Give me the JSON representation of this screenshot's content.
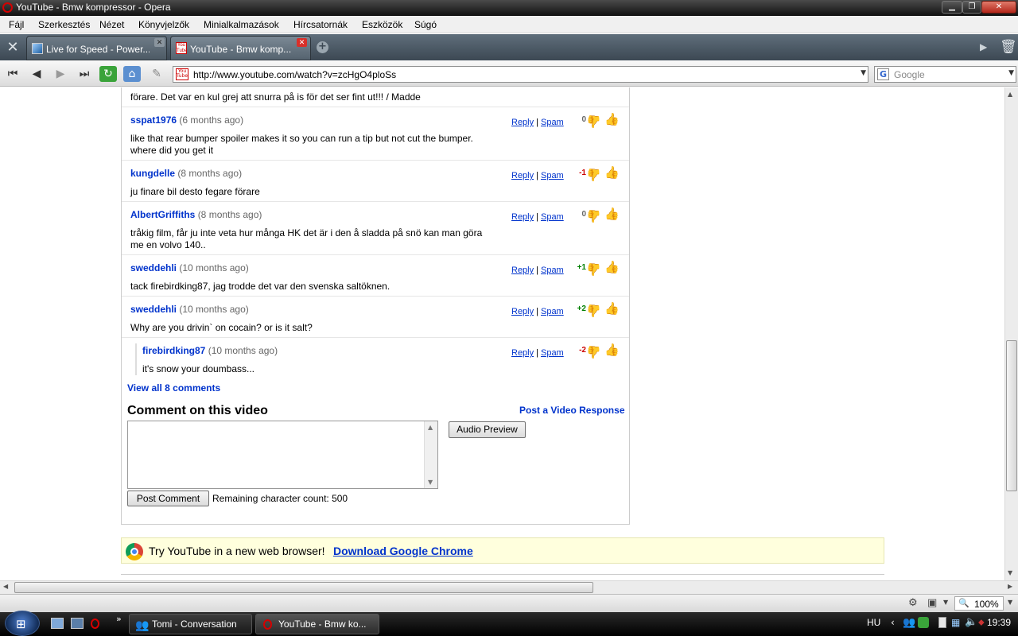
{
  "window": {
    "title": "YouTube - Bmw kompressor - Opera"
  },
  "menu": [
    "Fájl",
    "Szerkesztés",
    "Nézet",
    "Könyvjelzők",
    "Minialkalmazások",
    "Hírcsatornák",
    "Eszközök",
    "Súgó"
  ],
  "tabs": [
    {
      "label": "Live for Speed - Power...",
      "active": false
    },
    {
      "label": "YouTube - Bmw komp...",
      "active": true
    }
  ],
  "address": {
    "url": "http://www.youtube.com/watch?v=zcHgO4ploSs",
    "search_placeholder": "Google"
  },
  "comments": {
    "partial_text": "förare. Det var en kul grej att snurra på is för det ser fint ut!!! / Madde",
    "reply_label": "Reply",
    "spam_label": "Spam",
    "items": [
      {
        "user": "sspat1976",
        "ago": "(6 months ago)",
        "text": "like that rear bumper spoiler makes it so you can run a tip but not cut the bumper. where did you get it",
        "score": "0"
      },
      {
        "user": "kungdelle",
        "ago": "(8 months ago)",
        "text": "ju finare bil desto fegare förare",
        "score": "-1"
      },
      {
        "user": "AlbertGriffiths",
        "ago": "(8 months ago)",
        "text": "tråkig film, får ju inte veta hur många HK det är i den å sladda på snö kan man göra me en volvo 140..",
        "score": "0"
      },
      {
        "user": "sweddehli",
        "ago": "(10 months ago)",
        "text": "tack firebirdking87, jag trodde det var den svenska saltöknen.",
        "score": "+1"
      },
      {
        "user": "sweddehli",
        "ago": "(10 months ago)",
        "text": "Why are you drivin` on cocain? or is it salt?",
        "score": "+2"
      },
      {
        "user": "firebirdking87",
        "ago": "(10 months ago)",
        "text": "it's snow your doumbass...",
        "score": "-2"
      }
    ],
    "view_all": "View all 8 comments",
    "heading": "Comment on this video",
    "post_video_response": "Post a Video Response",
    "audio_preview": "Audio Preview",
    "post_comment": "Post Comment",
    "remaining": "Remaining character count: 500"
  },
  "chrome_promo": {
    "text": "Try YouTube in a new web browser!",
    "link": "Download Google Chrome"
  },
  "statusbar": {
    "zoom": "100%"
  },
  "taskbar": {
    "buttons": [
      "Tomi - Conversation",
      "YouTube - Bmw ko..."
    ],
    "lang": "HU",
    "clock": "19:39"
  },
  "colors": {
    "link_blue": "#0033cc",
    "positive": "#008000",
    "negative": "#cc0000",
    "promo_bg": "#ffffdd"
  }
}
